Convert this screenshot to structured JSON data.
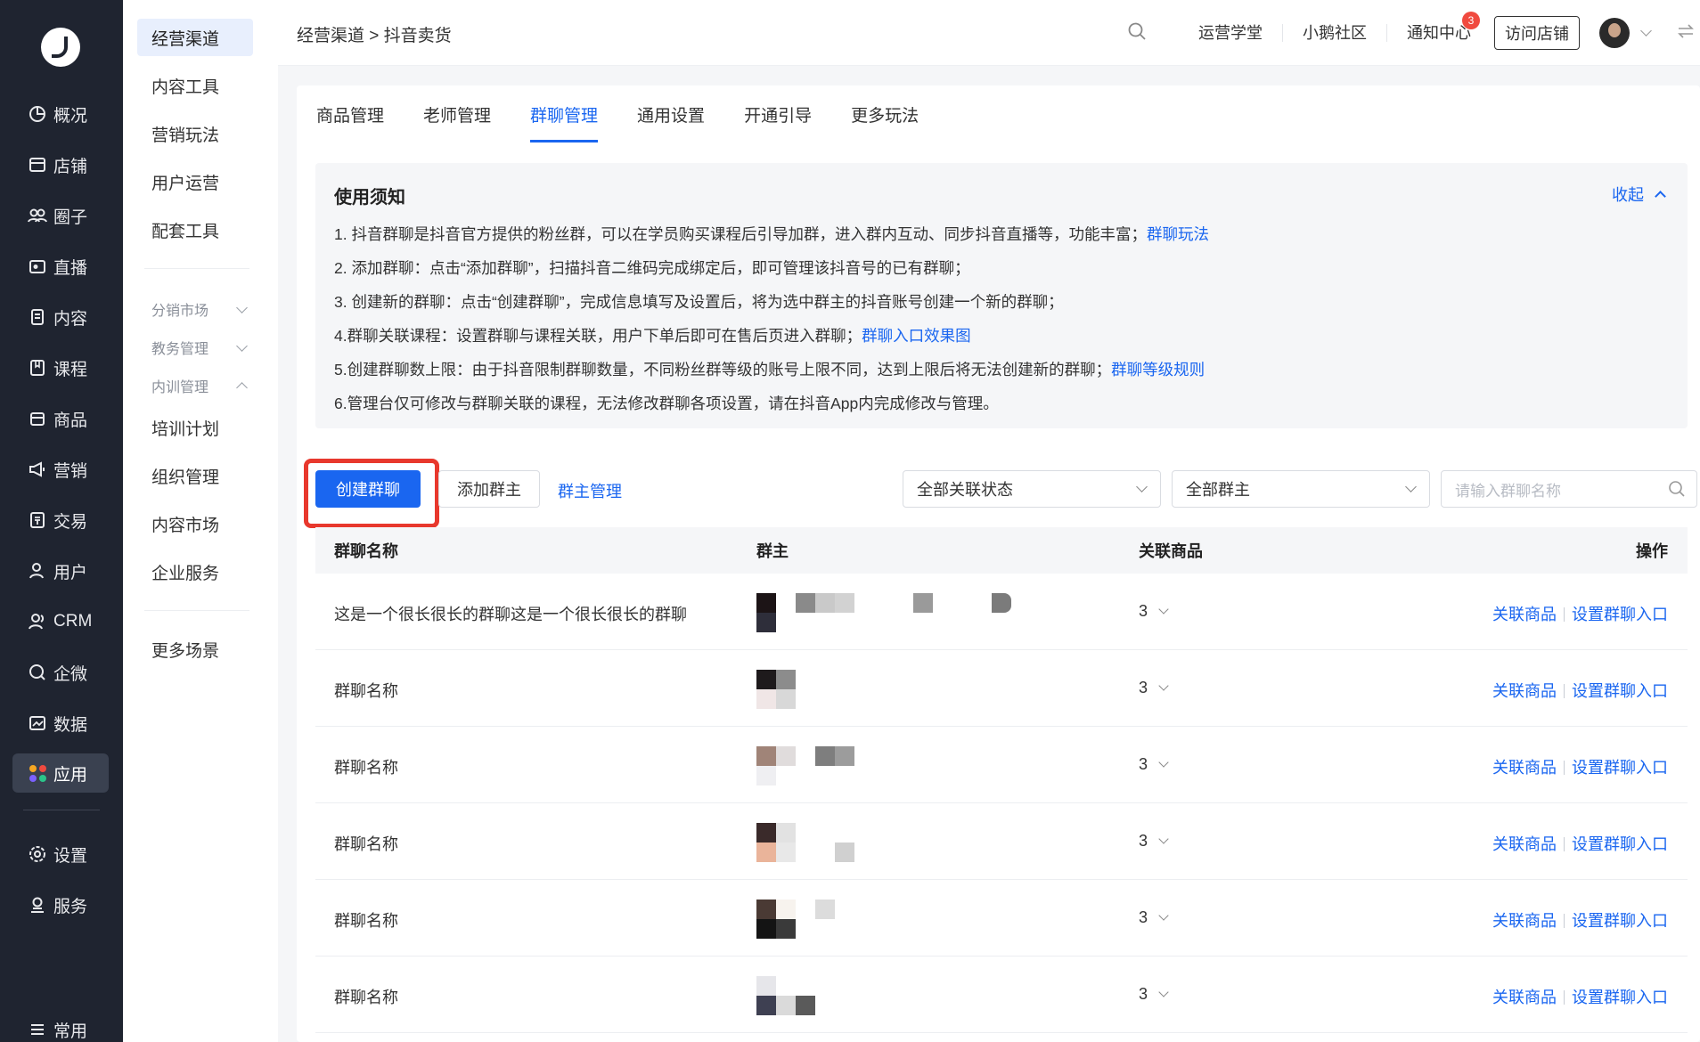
{
  "nav1": {
    "items": [
      {
        "label": "概况",
        "icon": "pie-chart-icon"
      },
      {
        "label": "店铺",
        "icon": "store-icon"
      },
      {
        "label": "圈子",
        "icon": "users-group-icon"
      },
      {
        "label": "直播",
        "icon": "live-camera-icon"
      },
      {
        "label": "内容",
        "icon": "document-icon"
      },
      {
        "label": "课程",
        "icon": "book-icon"
      },
      {
        "label": "商品",
        "icon": "bag-icon"
      },
      {
        "label": "营销",
        "icon": "megaphone-icon"
      },
      {
        "label": "交易",
        "icon": "receipt-icon"
      },
      {
        "label": "用户",
        "icon": "user-icon"
      },
      {
        "label": "CRM",
        "icon": "crm-icon"
      },
      {
        "label": "企微",
        "icon": "chat-icon"
      },
      {
        "label": "数据",
        "icon": "chart-icon"
      },
      {
        "label": "应用",
        "icon": "apps-icon"
      }
    ],
    "active": "应用",
    "bottom_items": [
      {
        "label": "设置",
        "icon": "gear-icon"
      },
      {
        "label": "服务",
        "icon": "service-icon"
      }
    ],
    "footer_label": "常用"
  },
  "nav2": {
    "items_top": [
      "经营渠道",
      "内容工具",
      "营销玩法",
      "用户运营",
      "配套工具"
    ],
    "groups": [
      {
        "label": "分销市场",
        "expanded": false
      },
      {
        "label": "教务管理",
        "expanded": false
      },
      {
        "label": "内训管理",
        "expanded": true
      }
    ],
    "sub_items": [
      "培训计划",
      "组织管理",
      "内容市场",
      "企业服务"
    ],
    "more": "更多场景"
  },
  "topbar": {
    "breadcrumb": "经营渠道 > 抖音卖货",
    "links": [
      "运营学堂",
      "小鹅社区",
      "通知中心"
    ],
    "notification_count": "3",
    "visit_store": "访问店铺"
  },
  "tabs": [
    "商品管理",
    "老师管理",
    "群聊管理",
    "通用设置",
    "开通引导",
    "更多玩法"
  ],
  "active_tab": "群聊管理",
  "notice": {
    "title": "使用须知",
    "collapse_label": "收起",
    "lines": [
      {
        "text": "1. 抖音群聊是抖音官方提供的粉丝群，可以在学员购买课程后引导加群，进入群内互动、同步抖音直播等，功能丰富；",
        "link": "群聊玩法"
      },
      {
        "text": "2. 添加群聊：点击“添加群聊”，扫描抖音二维码完成绑定后，即可管理该抖音号的已有群聊；",
        "link": ""
      },
      {
        "text": "3. 创建新的群聊：点击“创建群聊”，完成信息填写及设置后，将为选中群主的抖音账号创建一个新的群聊；",
        "link": ""
      },
      {
        "text": "4.群聊关联课程：设置群聊与课程关联，用户下单后即可在售后页进入群聊；",
        "link": "群聊入口效果图"
      },
      {
        "text": "5.创建群聊数上限：由于抖音限制群聊数量，不同粉丝群等级的账号上限不同，达到上限后将无法创建新的群聊；",
        "link": "群聊等级规则"
      },
      {
        "text": "6.管理台仅可修改与群聊关联的课程，无法修改群聊各项设置，请在抖音App内完成修改与管理。",
        "link": ""
      }
    ]
  },
  "toolbar": {
    "create_label": "创建群聊",
    "add_owner_label": "添加群主",
    "owner_manage_label": "群主管理",
    "filter_status": "全部关联状态",
    "filter_owner": "全部群主",
    "search_placeholder": "请输入群聊名称"
  },
  "table": {
    "headers": [
      "群聊名称",
      "群主",
      "关联商品",
      "操作"
    ],
    "op_labels": [
      "关联商品",
      "设置群聊入口"
    ],
    "rows": [
      {
        "name": "这是一个很长很长的群聊这是一个很长很长的群聊",
        "goods": "3"
      },
      {
        "name": "群聊名称",
        "goods": "3"
      },
      {
        "name": "群聊名称",
        "goods": "3"
      },
      {
        "name": "群聊名称",
        "goods": "3"
      },
      {
        "name": "群聊名称",
        "goods": "3"
      },
      {
        "name": "群聊名称",
        "goods": "3"
      }
    ]
  },
  "colors": {
    "accent": "#1a66f0",
    "highlight": "#e8382d",
    "nav_bg": "#1f2430"
  }
}
